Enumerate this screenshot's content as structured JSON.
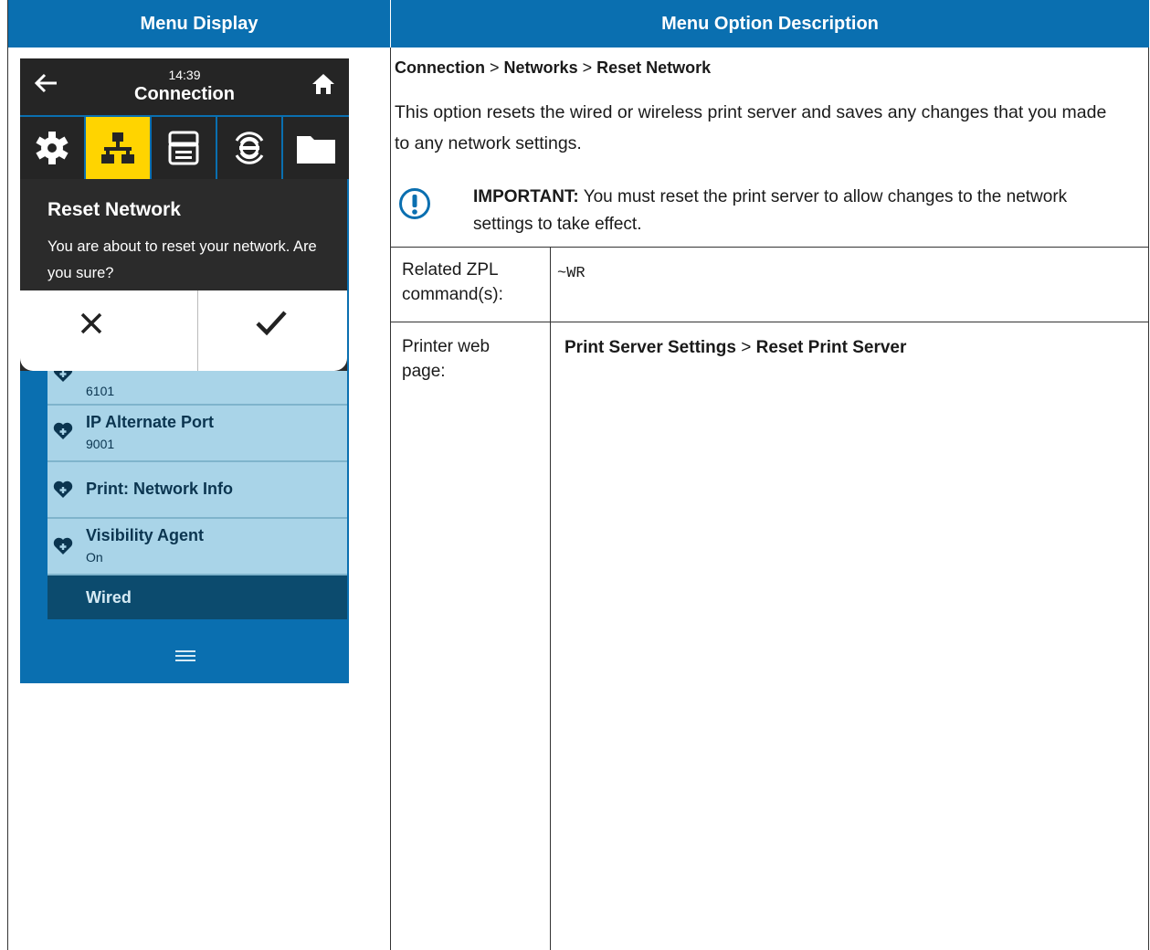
{
  "table": {
    "header_left": "Menu Display",
    "header_right": "Menu Option Description"
  },
  "description": {
    "path": [
      "Connection",
      "Networks",
      "Reset Network"
    ],
    "path_sep": ">",
    "text": "This option resets the wired or wireless print server and saves any changes that you made to any network settings.",
    "note_label": "IMPORTANT:",
    "note_text": "You must reset the print server to allow changes to the network settings to take effect.",
    "zpl_label_line1": "Related ZPL",
    "zpl_label_line2": "command(s):",
    "zpl_value": "~WR",
    "web_label_line1": "Printer web",
    "web_label_line2": "page:",
    "web_value_part1": "Print Server Settings",
    "web_value_sep": ">",
    "web_value_part2": "Reset Print Server"
  },
  "device": {
    "time": "14:39",
    "title": "Connection",
    "dialog_title": "Reset Network",
    "dialog_text": "You are about to reset your network. Are you sure?",
    "items": [
      {
        "title": "",
        "sub": "6101"
      },
      {
        "title": "IP Alternate Port",
        "sub": "9001"
      },
      {
        "title": "Print: Network Info",
        "sub": ""
      },
      {
        "title": "Visibility Agent",
        "sub": "On"
      }
    ],
    "section": "Wired",
    "colors": {
      "blue": "#0a6fb0",
      "active_tab": "#ffd400",
      "dark": "#252525",
      "item": "#a9d4e8"
    }
  }
}
